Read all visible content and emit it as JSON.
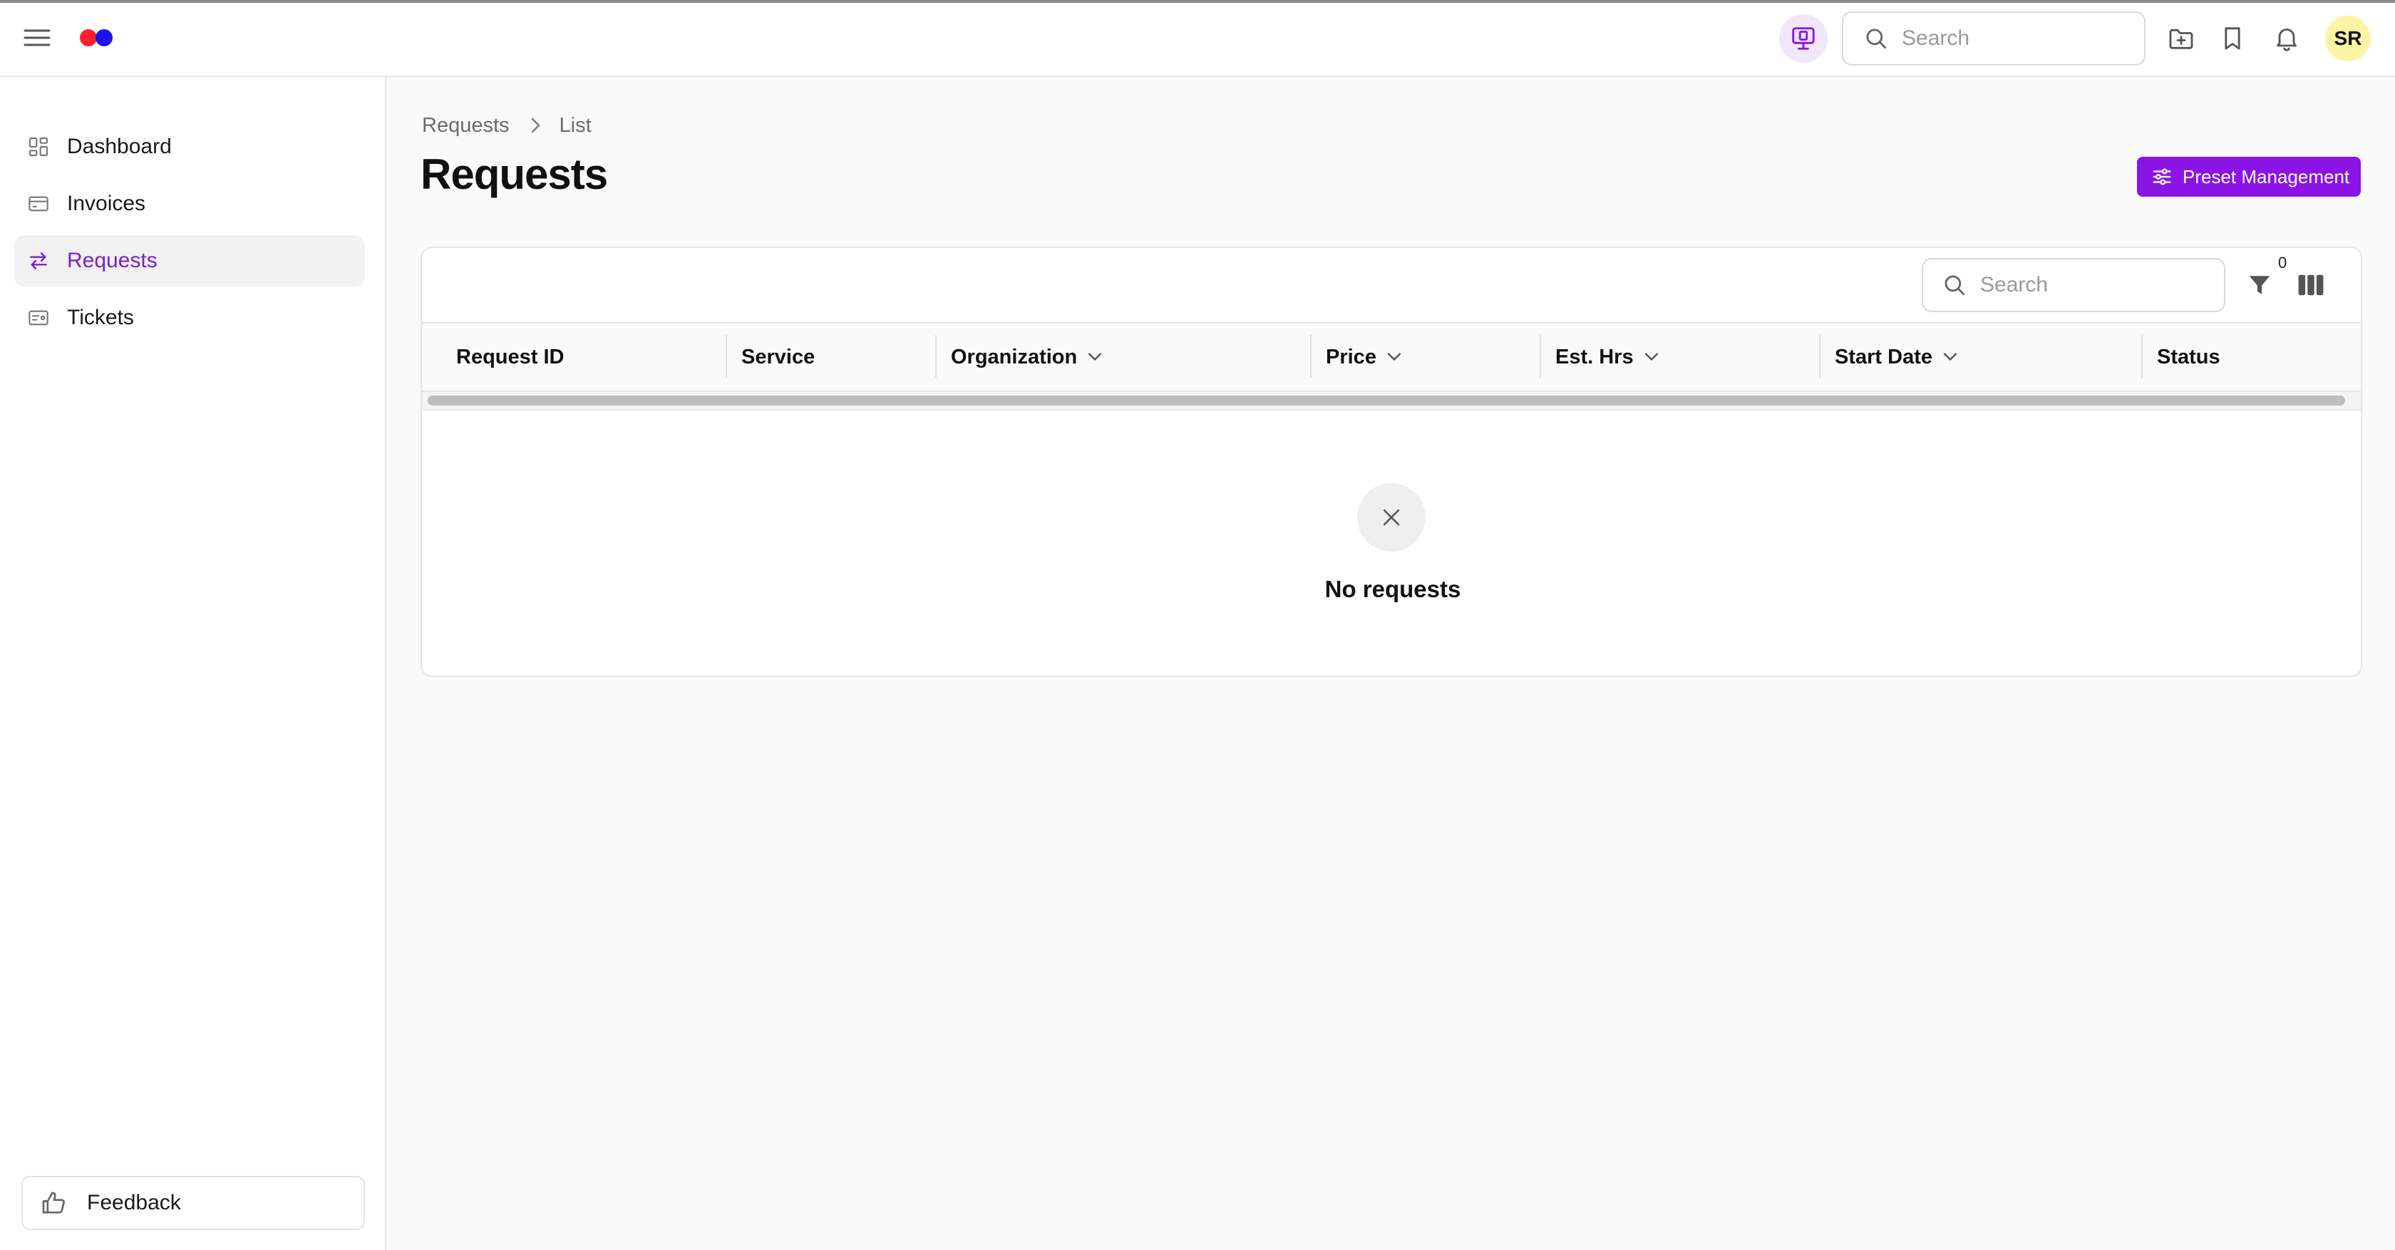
{
  "header": {
    "search_placeholder": "Search",
    "avatar_initials": "SR"
  },
  "sidebar": {
    "items": [
      {
        "label": "Dashboard",
        "icon": "dashboard-icon",
        "active": false
      },
      {
        "label": "Invoices",
        "icon": "invoice-icon",
        "active": false
      },
      {
        "label": "Requests",
        "icon": "swap-arrows-icon",
        "active": true
      },
      {
        "label": "Tickets",
        "icon": "ticket-icon",
        "active": false
      }
    ],
    "feedback_label": "Feedback"
  },
  "breadcrumb": [
    "Requests",
    "List"
  ],
  "page": {
    "title": "Requests",
    "preset_button": "Preset Management"
  },
  "table": {
    "search_placeholder": "Search",
    "filter_count": "0",
    "columns": [
      {
        "label": "Request ID",
        "sortable": false
      },
      {
        "label": "Service",
        "sortable": false
      },
      {
        "label": "Organization",
        "sortable": true
      },
      {
        "label": "Price",
        "sortable": true
      },
      {
        "label": "Est. Hrs",
        "sortable": true
      },
      {
        "label": "Start Date",
        "sortable": true
      },
      {
        "label": "Status",
        "sortable": false
      }
    ],
    "empty_text": "No requests"
  },
  "colors": {
    "accent": "#8a14e6",
    "active_nav_text": "#7b1fd1",
    "avatar_bg": "#fdf5a6",
    "logo_red": "#ff1f2d",
    "logo_blue": "#1d12e8"
  }
}
